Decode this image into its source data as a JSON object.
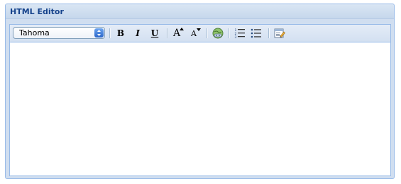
{
  "panel": {
    "title": "HTML Editor"
  },
  "toolbar": {
    "font_family": {
      "value": "Tahoma"
    },
    "buttons": [
      {
        "name": "bold-button",
        "icon": "bold-icon",
        "glyph": "B"
      },
      {
        "name": "italic-button",
        "icon": "italic-icon",
        "glyph": "I"
      },
      {
        "name": "underline-button",
        "icon": "underline-icon",
        "glyph": "U"
      },
      {
        "name": "increase-font-size-button",
        "icon": "font-size-increase-icon",
        "glyph": "A"
      },
      {
        "name": "decrease-font-size-button",
        "icon": "font-size-decrease-icon",
        "glyph": "A"
      },
      {
        "name": "create-link-button",
        "icon": "link-globe-icon"
      },
      {
        "name": "ordered-list-button",
        "icon": "ordered-list-icon"
      },
      {
        "name": "unordered-list-button",
        "icon": "unordered-list-icon"
      },
      {
        "name": "source-edit-button",
        "icon": "source-edit-icon"
      }
    ]
  },
  "editor": {
    "content": ""
  },
  "colors": {
    "border": "#99bbe8",
    "title": "#15428b",
    "panel_bg": "#d0def0",
    "toolbar_bg": "#dfe8f6"
  }
}
